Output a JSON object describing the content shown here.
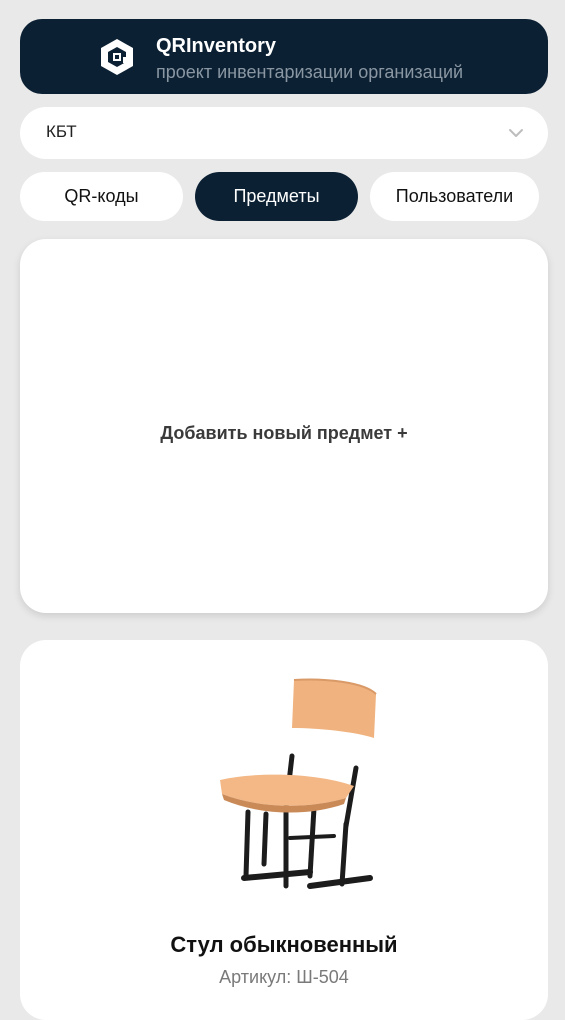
{
  "header": {
    "title": "QRInventory",
    "subtitle": "проект инвентаризации организаций",
    "logo_icon": "qr-hexagon-logo-icon",
    "background_color": "#0b2033"
  },
  "organization_select": {
    "selected_value": "КБТ",
    "chevron_icon": "chevron-down-icon"
  },
  "tabs": [
    {
      "label": "QR-коды",
      "active": false
    },
    {
      "label": "Предметы",
      "active": true
    },
    {
      "label": "Пользователи",
      "active": false
    }
  ],
  "add_item": {
    "label": "Добавить новый предмет +"
  },
  "items": [
    {
      "name": "Стул обыкновенный",
      "article": "Артикул: Ш-504",
      "image_icon": "chair-image"
    }
  ],
  "colors": {
    "accent": "#0b2033",
    "background": "#e9e9e9",
    "card": "#ffffff",
    "wood": "#f0b27e",
    "metal": "#1c1c1c"
  }
}
